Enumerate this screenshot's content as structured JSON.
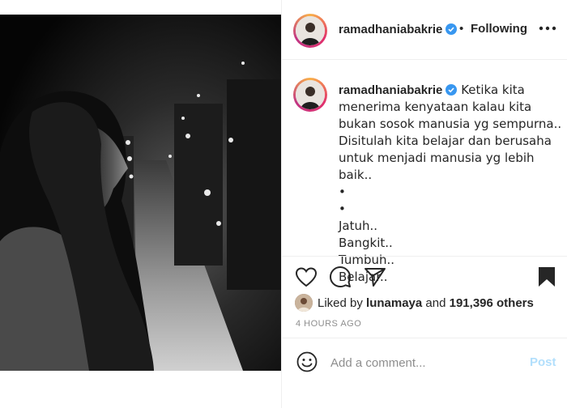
{
  "post": {
    "username": "ramadhaniabakrie",
    "separator": "•",
    "follow_status": "Following",
    "caption_lines": [
      "Ketika kita menerima kenyataan kalau kita bukan sosok manusia yg sempurna..",
      "Disitulah kita belajar dan berusaha untuk menjadi manusia yg lebih baik..",
      "•",
      "•",
      "Jatuh..",
      "Bangkit..",
      "Tumbuh..",
      "Belajar.."
    ],
    "liked_by_prefix": "Liked by",
    "liked_by_user": "lunamaya",
    "liked_by_and": "and",
    "likes_others": "191,396 others",
    "time_ago": "4 HOURS AGO",
    "comment_placeholder": "Add a comment...",
    "post_label": "Post"
  },
  "icons": {
    "more": "more-options-icon",
    "like": "heart-icon",
    "comment": "comment-icon",
    "share": "share-icon",
    "save": "bookmark-icon",
    "verified": "verified-badge-icon",
    "emoji": "emoji-icon"
  },
  "colors": {
    "verified": "#3897f0",
    "post_disabled": "#b2dffc",
    "muted_text": "#8e8e8e",
    "text": "#262626"
  }
}
